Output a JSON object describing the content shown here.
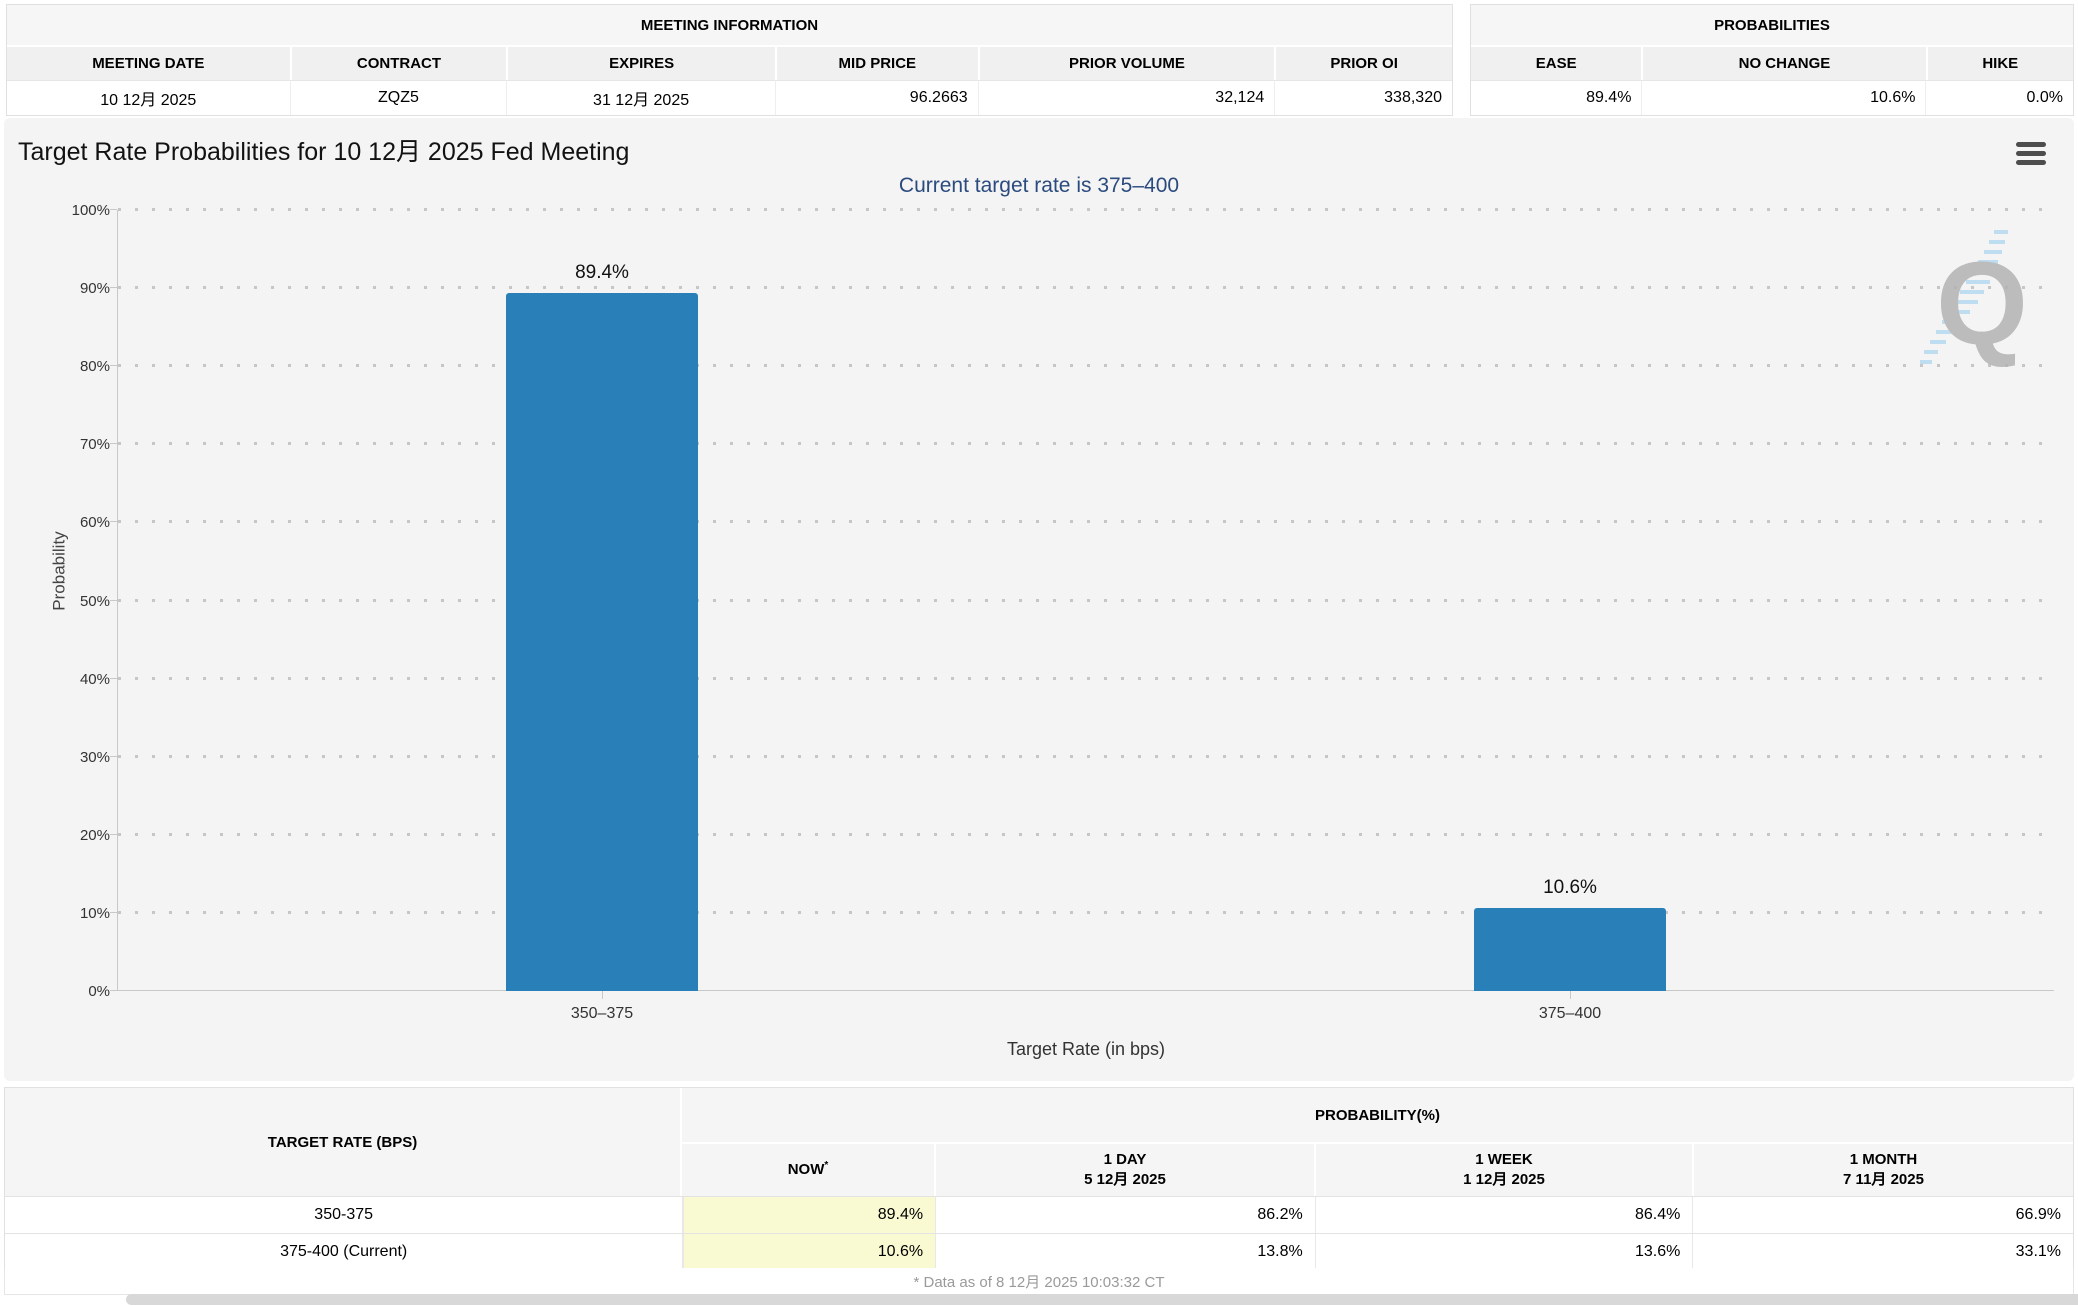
{
  "meeting_information": {
    "title": "MEETING INFORMATION",
    "headers": [
      "MEETING DATE",
      "CONTRACT",
      "EXPIRES",
      "MID PRICE",
      "PRIOR VOLUME",
      "PRIOR OI"
    ],
    "values": [
      "10 12月 2025",
      "ZQZ5",
      "31 12月 2025",
      "96.2663",
      "32,124",
      "338,320"
    ]
  },
  "probabilities_summary": {
    "title": "PROBABILITIES",
    "headers": [
      "EASE",
      "NO CHANGE",
      "HIKE"
    ],
    "values": [
      "89.4%",
      "10.6%",
      "0.0%"
    ]
  },
  "chart": {
    "title": "Target Rate Probabilities for 10 12月 2025 Fed Meeting",
    "subtitle": "Current target rate is 375–400",
    "watermark_letter": "Q"
  },
  "chart_data": {
    "type": "bar",
    "categories": [
      "350–375",
      "375–400"
    ],
    "values": [
      89.4,
      10.6
    ],
    "labels": [
      "89.4%",
      "10.6%"
    ],
    "title": "Target Rate Probabilities for 10 12月 2025 Fed Meeting",
    "subtitle": "Current target rate is 375–400",
    "xlabel": "Target Rate (in bps)",
    "ylabel": "Probability",
    "ylim": [
      0,
      100
    ],
    "ytick_step": 10,
    "ytick_suffix": "%",
    "bar_color": "#2980b9",
    "grid": "dotted horizontal",
    "legend": "none"
  },
  "probability_table": {
    "target_header": "TARGET RATE (BPS)",
    "group_header": "PROBABILITY(%)",
    "columns": [
      {
        "label": "NOW",
        "sup": "*",
        "date": ""
      },
      {
        "label": "1 DAY",
        "date": "5 12月 2025"
      },
      {
        "label": "1 WEEK",
        "date": "1 12月 2025"
      },
      {
        "label": "1 MONTH",
        "date": "7 11月 2025"
      }
    ],
    "rows": [
      {
        "rate": "350-375",
        "now": "89.4%",
        "day": "86.2%",
        "week": "86.4%",
        "month": "66.9%"
      },
      {
        "rate": "375-400 (Current)",
        "now": "10.6%",
        "day": "13.8%",
        "week": "13.6%",
        "month": "33.1%"
      }
    ],
    "footnote": "* Data as of 8 12月 2025 10:03:32 CT"
  },
  "colors": {
    "bar": "#2980b9",
    "highlight": "#fafad2",
    "subtitle": "#2b4b7e",
    "panel_bg": "#f4f4f4"
  }
}
